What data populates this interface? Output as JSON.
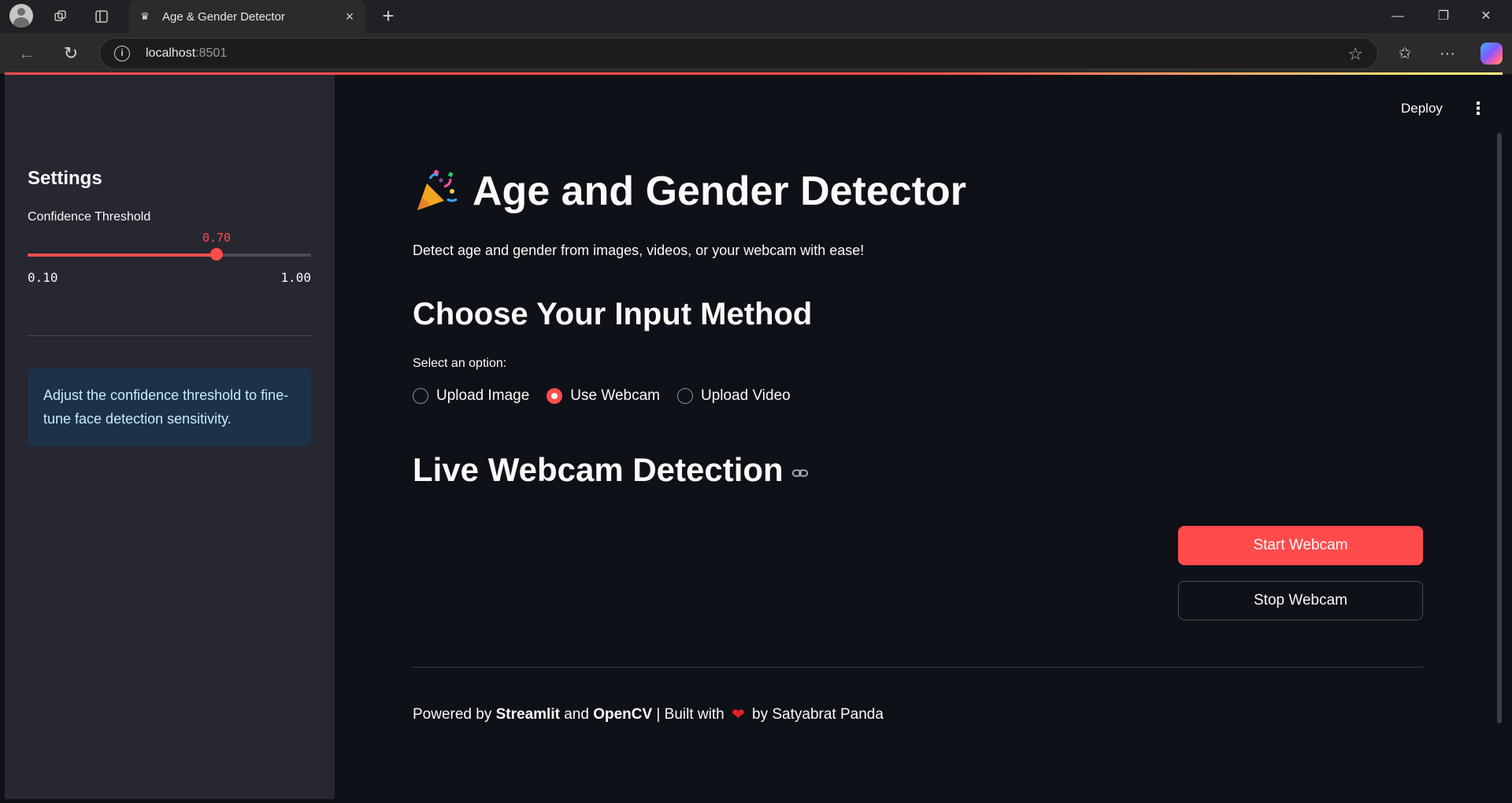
{
  "browser": {
    "tab_title": "Age & Gender Detector",
    "url_host": "localhost",
    "url_port": ":8501"
  },
  "sidebar": {
    "title": "Settings",
    "slider": {
      "label": "Confidence Threshold",
      "value": 0.7,
      "value_text": "0.70",
      "min": 0.1,
      "max": 1.0,
      "min_text": "0.10",
      "max_text": "1.00"
    },
    "info": "Adjust the confidence threshold to fine-tune face detection sensitivity."
  },
  "header": {
    "deploy_label": "Deploy"
  },
  "main": {
    "title": "Age and Gender Detector",
    "subtitle": "Detect age and gender from images, videos, or your webcam with ease!",
    "input_heading": "Choose Your Input Method",
    "radio_label": "Select an option:",
    "options": [
      "Upload Image",
      "Use Webcam",
      "Upload Video"
    ],
    "selected_option": "Use Webcam",
    "section_heading": "Live Webcam Detection",
    "start_button": "Start Webcam",
    "stop_button": "Stop Webcam"
  },
  "footer": {
    "prefix": "Powered by ",
    "streamlit": "Streamlit",
    "and": " and ",
    "opencv": "OpenCV",
    "built": " | Built with ",
    "author": " by Satyabrat Panda"
  },
  "colors": {
    "accent": "#ff4b4b",
    "background": "#0e1117",
    "sidebar": "#262730",
    "info_bg": "#1d3148"
  }
}
